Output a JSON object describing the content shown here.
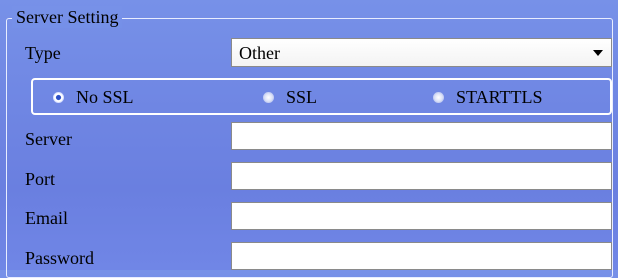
{
  "section": {
    "legend": "Server Setting"
  },
  "type_field": {
    "label": "Type",
    "selected": "Other"
  },
  "security": {
    "options": [
      {
        "label": "No SSL",
        "selected": true
      },
      {
        "label": "SSL",
        "selected": false
      },
      {
        "label": "STARTTLS",
        "selected": false
      }
    ]
  },
  "fields": {
    "server": {
      "label": "Server",
      "value": "",
      "placeholder": ""
    },
    "port": {
      "label": "Port",
      "value": "",
      "placeholder": ""
    },
    "email": {
      "label": "Email",
      "value": "",
      "placeholder": ""
    },
    "password": {
      "label": "Password",
      "value": "",
      "placeholder": ""
    }
  },
  "colors": {
    "background": "#7086e6",
    "border": "#ffffff",
    "selected_radio": "#2c4fc6"
  },
  "icons": {
    "dropdown": "chevron-down-icon",
    "radio_selected": "radio-selected-icon",
    "radio_unselected": "radio-unselected-icon"
  }
}
